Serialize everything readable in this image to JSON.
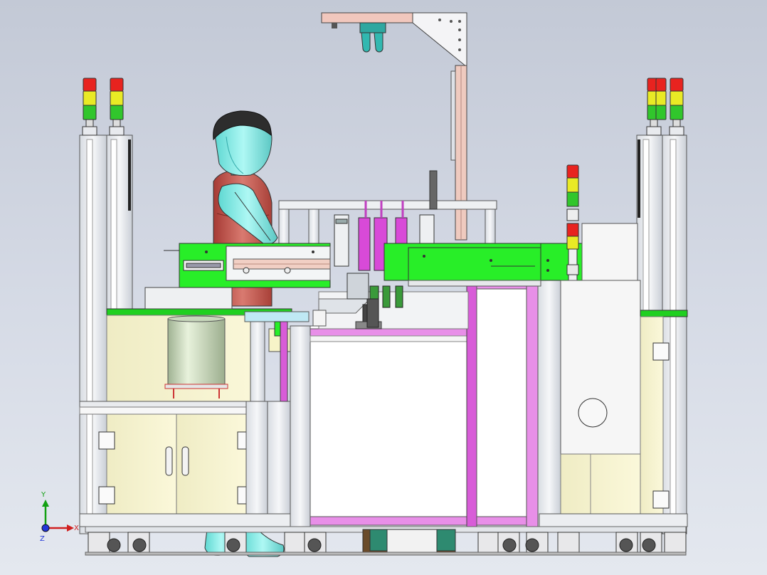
{
  "axes": {
    "y_label": "Y",
    "x_label": "X",
    "z_label": "Z"
  },
  "colors": {
    "background": "#cdd3df",
    "frame": "#e4e7ec",
    "panel": "#f6f3cf",
    "green": "#28ee28",
    "magenta": "#d24ad2",
    "pink_bar": "#e6b8ae",
    "cyan_body": "#8ef0ec",
    "red_shirt": "#c0554e"
  },
  "objects": {
    "left_tower_lights": 2,
    "right_tower_lights": 3,
    "center_tower_lights": 1
  }
}
